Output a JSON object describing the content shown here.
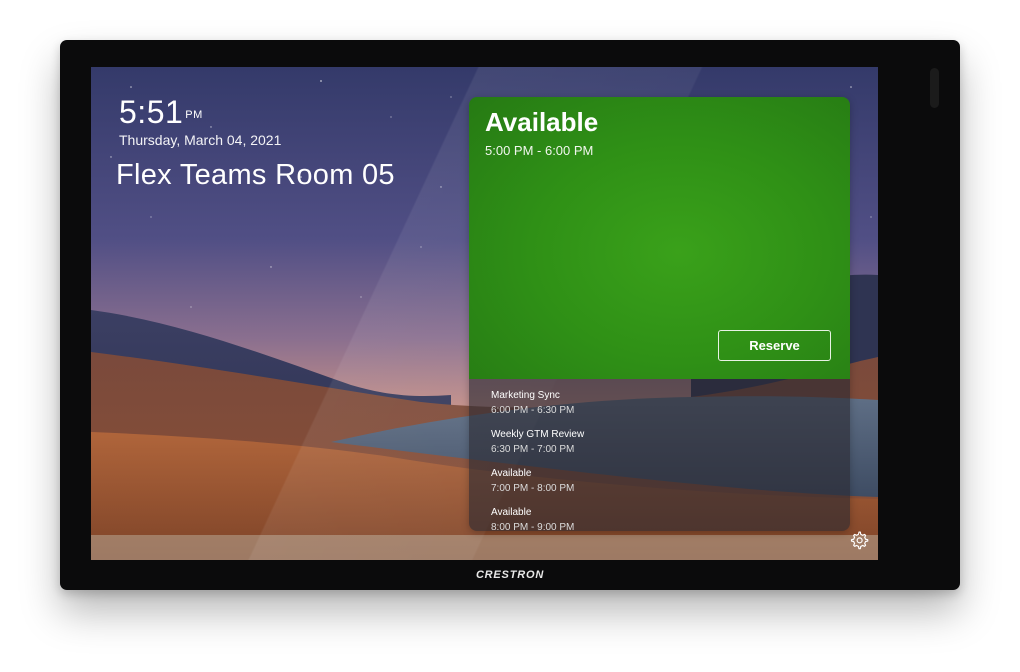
{
  "clock": {
    "time": "5:51",
    "ampm": "PM",
    "date": "Thursday, March 04, 2021"
  },
  "room": {
    "name": "Flex Teams Room 05"
  },
  "status": {
    "title": "Available",
    "time_range": "5:00 PM - 6:00 PM",
    "color": "#2f9016",
    "reserve_label": "Reserve"
  },
  "schedule": [
    {
      "title": "Marketing Sync",
      "time": "6:00 PM - 6:30 PM"
    },
    {
      "title": "Weekly GTM Review",
      "time": "6:30 PM - 7:00 PM"
    },
    {
      "title": "Available",
      "time": "7:00 PM - 8:00 PM"
    },
    {
      "title": "Available",
      "time": "8:00 PM - 9:00 PM"
    }
  ],
  "settings": {
    "icon": "gear-icon"
  },
  "device": {
    "brand": "CRESTRON"
  }
}
